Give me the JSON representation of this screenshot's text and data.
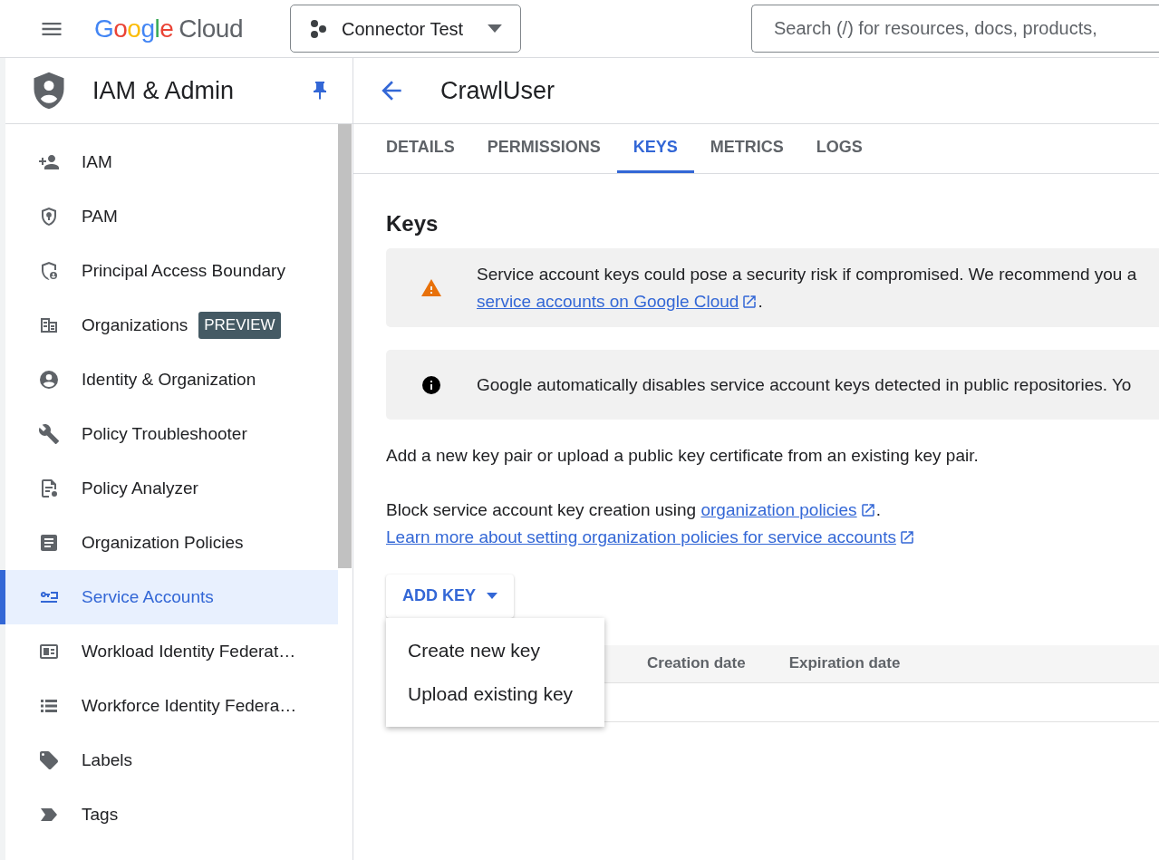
{
  "header": {
    "logo": {
      "brand": "Google",
      "product": "Cloud"
    },
    "project": "Connector Test",
    "search": {
      "placeholder": "Search (/) for resources, docs, products,"
    }
  },
  "sidebar": {
    "title": "IAM & Admin",
    "items": [
      {
        "label": "IAM",
        "selected": false
      },
      {
        "label": "PAM",
        "selected": false
      },
      {
        "label": "Principal Access Boundary",
        "selected": false
      },
      {
        "label": "Organizations",
        "badge": "PREVIEW",
        "selected": false
      },
      {
        "label": "Identity & Organization",
        "selected": false
      },
      {
        "label": "Policy Troubleshooter",
        "selected": false
      },
      {
        "label": "Policy Analyzer",
        "selected": false
      },
      {
        "label": "Organization Policies",
        "selected": false
      },
      {
        "label": "Service Accounts",
        "selected": true
      },
      {
        "label": "Workload Identity Federat…",
        "selected": false
      },
      {
        "label": "Workforce Identity Federa…",
        "selected": false
      },
      {
        "label": "Labels",
        "selected": false
      },
      {
        "label": "Tags",
        "selected": false
      }
    ]
  },
  "page": {
    "title": "CrawlUser",
    "tabs": [
      {
        "label": "DETAILS",
        "selected": false
      },
      {
        "label": "PERMISSIONS",
        "selected": false
      },
      {
        "label": "KEYS",
        "selected": true
      },
      {
        "label": "METRICS",
        "selected": false
      },
      {
        "label": "LOGS",
        "selected": false
      }
    ],
    "section_title": "Keys",
    "alerts": [
      {
        "kind": "warning",
        "text": "Service account keys could pose a security risk if compromised. We recommend you a",
        "link": "service accounts on Google Cloud",
        "after": "."
      },
      {
        "kind": "info",
        "text": "Google automatically disables service account keys detected in public repositories. Yo"
      }
    ],
    "intro": "Add a new key pair or upload a public key certificate from an existing key pair.",
    "block_text": "Block service account key creation using ",
    "block_link": "organization policies",
    "block_after": ".",
    "learn_link": "Learn more about setting organization policies for service accounts",
    "add_key": "ADD KEY",
    "menu": [
      "Create new key",
      "Upload existing key"
    ],
    "table": {
      "columns": [
        "Creation date",
        "Expiration date"
      ]
    }
  }
}
